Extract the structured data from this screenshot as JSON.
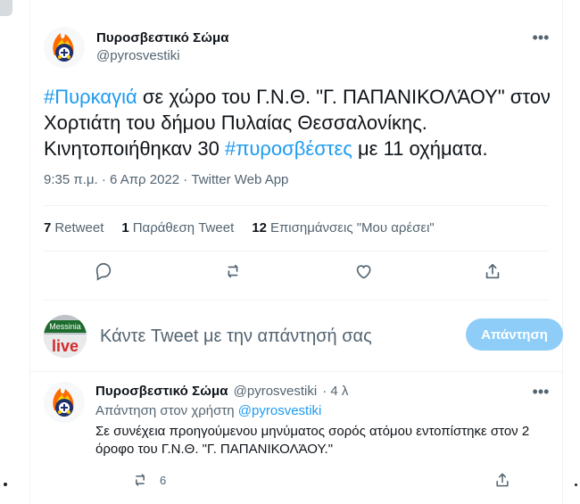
{
  "tweet": {
    "author_name": "Πυροσβεστικό Σώμα",
    "author_handle": "@pyrosvestiki",
    "text_parts": {
      "hashtag1": "#Πυρκαγιά",
      "part1": " σε χώρο του Γ.Ν.Θ. \"Γ. ΠΑΠΑΝΙΚΟΛΆΟΥ\" στον Χορτιάτη του δήμου Πυλαίας Θεσσαλονίκης. Κινητοποιήθηκαν 30 ",
      "hashtag2": "#πυροσβέστες",
      "part2": " με 11 οχήματα."
    },
    "meta": "9:35 π.μ. · 6 Απρ 2022 · Twitter Web App",
    "stats": {
      "retweets_num": "7",
      "retweets_label": "Retweet",
      "quotes_num": "1",
      "quotes_label": "Παράθεση Tweet",
      "likes_num": "12",
      "likes_label": "Επισημάνσεις \"Μου αρέσει\""
    }
  },
  "compose": {
    "placeholder": "Κάντε Tweet με την απάντησή σας",
    "reply_button": "Απάντηση",
    "avatar_text_top": "Messinia",
    "avatar_text_bottom": "live"
  },
  "reply": {
    "author_name": "Πυροσβεστικό Σώμα",
    "author_handle": "@pyrosvestiki",
    "time": "· 4 λ",
    "reply_to_prefix": "Απάντηση στον χρήστη ",
    "reply_to_handle": "@pyrosvestiki",
    "text": "Σε συνέχεια προηγούμενου μηνύματος σορός ατόμου εντοπίστηκε στον 2 όροφο του Γ.Ν.Θ. \"Γ. ΠΑΠΑΝΙΚΟΛΆΟΥ.\"",
    "retweets": "6"
  },
  "icons": {
    "more": "more-icon",
    "reply": "reply-icon",
    "retweet": "retweet-icon",
    "like": "like-icon",
    "share": "share-icon"
  },
  "colors": {
    "accent": "#1d9bf0",
    "muted": "#536471",
    "disabled_button": "#8ecdf8"
  }
}
